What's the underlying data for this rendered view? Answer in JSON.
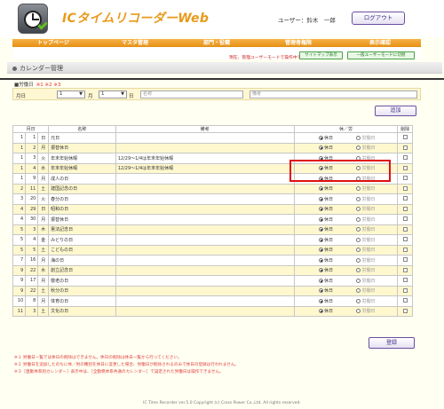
{
  "header": {
    "title": "ICタイムリコーダーWeb",
    "user": "ユーザー：鈴木　一郎",
    "logout": "ログアウト"
  },
  "nav": [
    "トップページ",
    "マスタ管理",
    "部門・役職",
    "管理者権限",
    "表示確認"
  ],
  "subbar": {
    "message": "現在、管理ユーザーモードで操作中です。",
    "sitemap": "サイトマップ表示",
    "switch_mode": "一般ユーザーモードに切替"
  },
  "section": {
    "title": "カレンダー管理"
  },
  "holiday_label": "■労働日",
  "holiday_legend": "※1 ※2 ※3",
  "filter": {
    "month_label": "月日",
    "month_value": "1",
    "month_unit": "月",
    "day_value": "1",
    "day_unit": "日",
    "name_placeholder": "名称",
    "note_placeholder": "備考",
    "add_button": "追加"
  },
  "table": {
    "headers": [
      "月日",
      "名称",
      "備考",
      "休／労",
      "削除"
    ],
    "radio_labels": {
      "holiday": "休日",
      "workday": "労働日"
    },
    "rows": [
      {
        "month": "1",
        "day": "1",
        "weekday": "日",
        "name": "元日",
        "note": ""
      },
      {
        "month": "1",
        "day": "2",
        "weekday": "月",
        "name": "振替休日",
        "note": ""
      },
      {
        "month": "1",
        "day": "3",
        "weekday": "火",
        "name": "年末年始休暇",
        "note": "12/29〜1/4は年末年始休暇"
      },
      {
        "month": "1",
        "day": "4",
        "weekday": "水",
        "name": "年末年始休暇",
        "note": "12/29〜1/4は年末年始休暇"
      },
      {
        "month": "1",
        "day": "9",
        "weekday": "月",
        "name": "成人の日",
        "note": ""
      },
      {
        "month": "2",
        "day": "11",
        "weekday": "土",
        "name": "建国記念の日",
        "note": ""
      },
      {
        "month": "3",
        "day": "20",
        "weekday": "火",
        "name": "春分の日",
        "note": ""
      },
      {
        "month": "4",
        "day": "29",
        "weekday": "日",
        "name": "昭和の日",
        "note": ""
      },
      {
        "month": "4",
        "day": "30",
        "weekday": "月",
        "name": "振替休日",
        "note": ""
      },
      {
        "month": "5",
        "day": "3",
        "weekday": "木",
        "name": "憲法記念日",
        "note": ""
      },
      {
        "month": "5",
        "day": "4",
        "weekday": "金",
        "name": "みどりの日",
        "note": ""
      },
      {
        "month": "5",
        "day": "5",
        "weekday": "土",
        "name": "こどもの日",
        "note": ""
      },
      {
        "month": "7",
        "day": "16",
        "weekday": "月",
        "name": "海の日",
        "note": ""
      },
      {
        "month": "9",
        "day": "22",
        "weekday": "水",
        "name": "創立記念日",
        "note": ""
      },
      {
        "month": "9",
        "day": "17",
        "weekday": "月",
        "name": "敬老の日",
        "note": ""
      },
      {
        "month": "9",
        "day": "22",
        "weekday": "土",
        "name": "秋分の日",
        "note": ""
      },
      {
        "month": "10",
        "day": "8",
        "weekday": "月",
        "name": "体育の日",
        "note": ""
      },
      {
        "month": "11",
        "day": "3",
        "weekday": "土",
        "name": "文化の日",
        "note": ""
      }
    ]
  },
  "register_button": "登録",
  "notes": [
    "※１ 労働日一覧では休日の削除はできません。休日の削除は休日一覧から行ってください。",
    "※２ 労働日を追加したのちに休／労の種別を休日に変更した場合、労働日が削除されるのみで休日の登録は行われません。",
    "※３［連動休系別カレンダー］表示中は、［全勤務体系共通のカレンダー］で設定された労働日は操作できません。"
  ],
  "footer": "IC Time Recorder ver.5.0 Copyright (c) Cross Power Co.,Ltd. All rights reserved.",
  "colors": {
    "accent_orange": "#e89a1a",
    "highlight_red": "#e01010",
    "row_band": "#fff8cf"
  }
}
